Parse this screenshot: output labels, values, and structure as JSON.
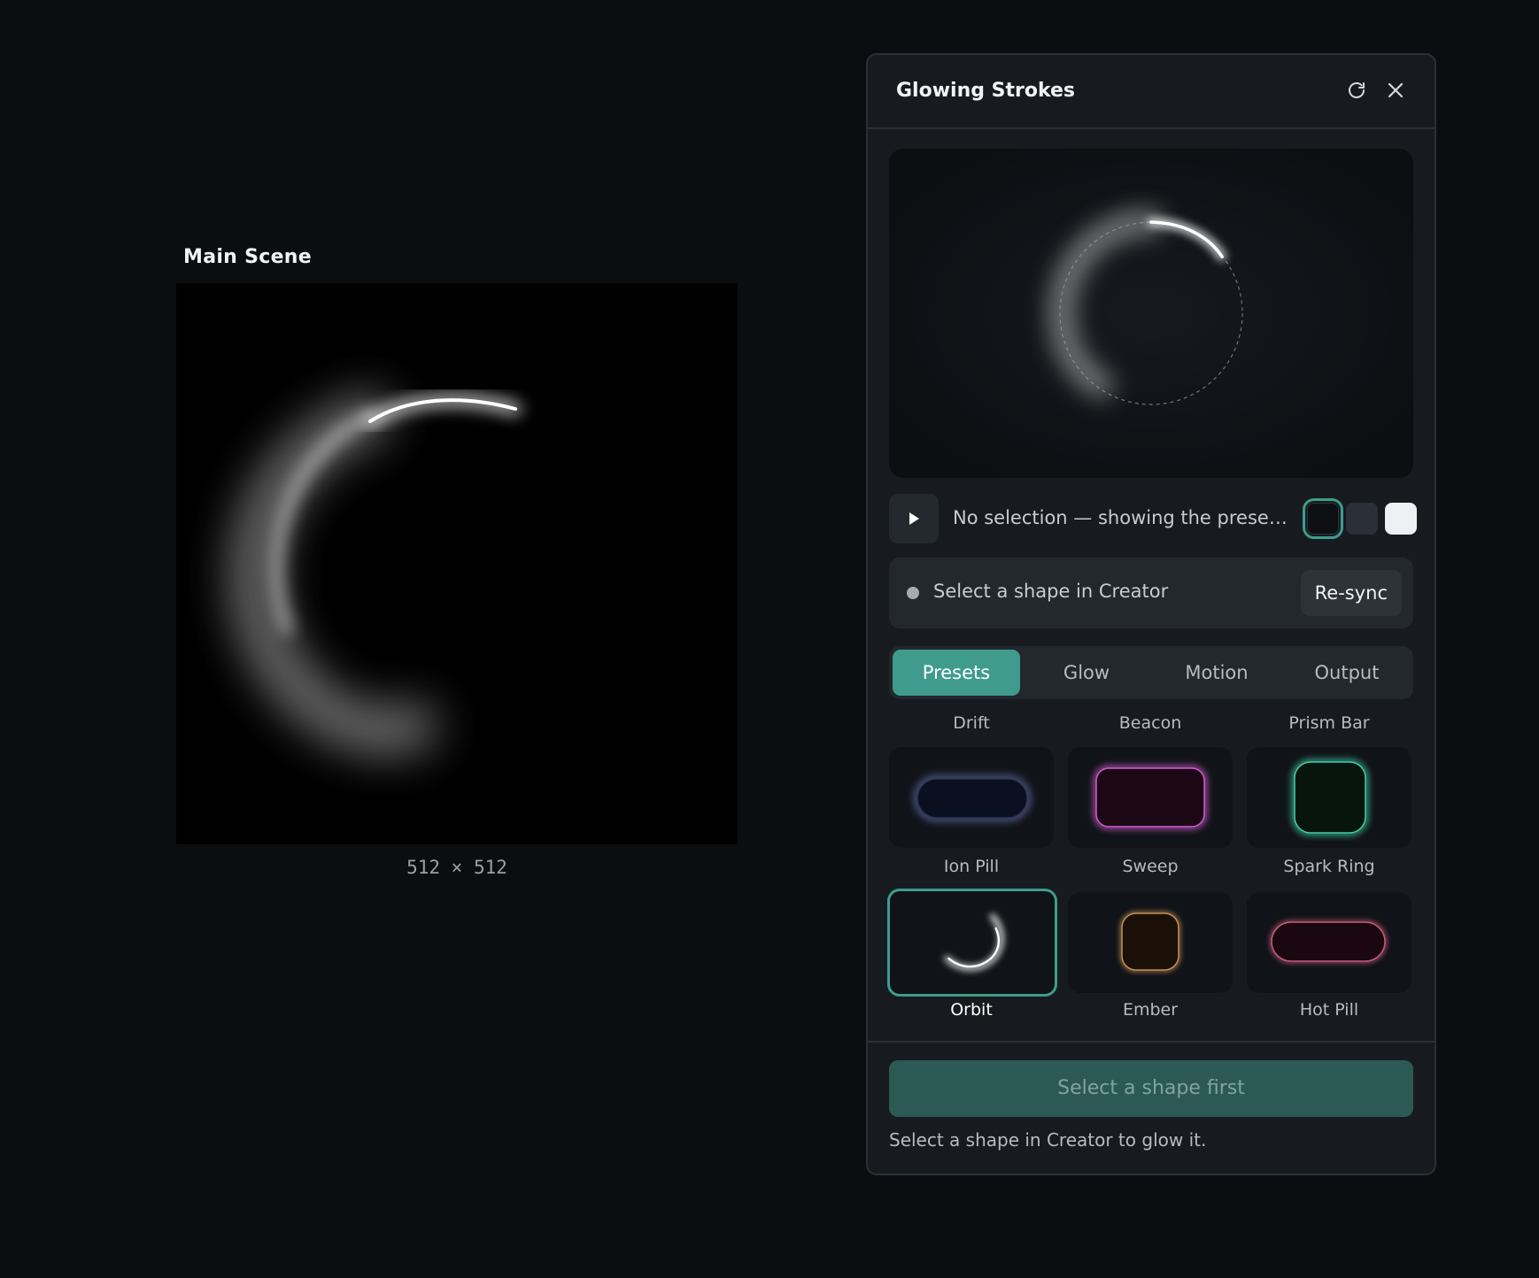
{
  "scene": {
    "title": "Main Scene",
    "size_label": "512 × 512"
  },
  "panel": {
    "title": "Glowing Strokes",
    "refresh_icon": "refresh-icon",
    "close_icon": "close-icon",
    "status_text": "No selection — showing the preset'...",
    "background_swatches": [
      {
        "name": "black",
        "color": "#0d0f12",
        "selected": true
      },
      {
        "name": "slate",
        "color": "#2a2f38",
        "selected": false
      },
      {
        "name": "white",
        "color": "#eef0f4",
        "selected": false
      }
    ],
    "sync": {
      "text": "Select a shape in Creator",
      "button_label": "Re-sync"
    },
    "tabs": [
      "Presets",
      "Glow",
      "Motion",
      "Output"
    ],
    "active_tab": "Presets",
    "top_labels": [
      "Drift",
      "Beacon",
      "Prism Bar"
    ],
    "presets": [
      {
        "name": "Ion Pill",
        "accent": "#8ea2ff"
      },
      {
        "name": "Sweep",
        "accent": "#d05bd0"
      },
      {
        "name": "Spark Ring",
        "accent": "#3fcfa8"
      },
      {
        "name": "Orbit",
        "accent": "#ffffff",
        "selected": true
      },
      {
        "name": "Ember",
        "accent": "#d19a5a"
      },
      {
        "name": "Hot Pill",
        "accent": "#d0607f"
      }
    ],
    "apply_button": "Select a shape first",
    "hint": "Select a shape in Creator to glow it.",
    "accent_color": "#3f9c8d"
  }
}
